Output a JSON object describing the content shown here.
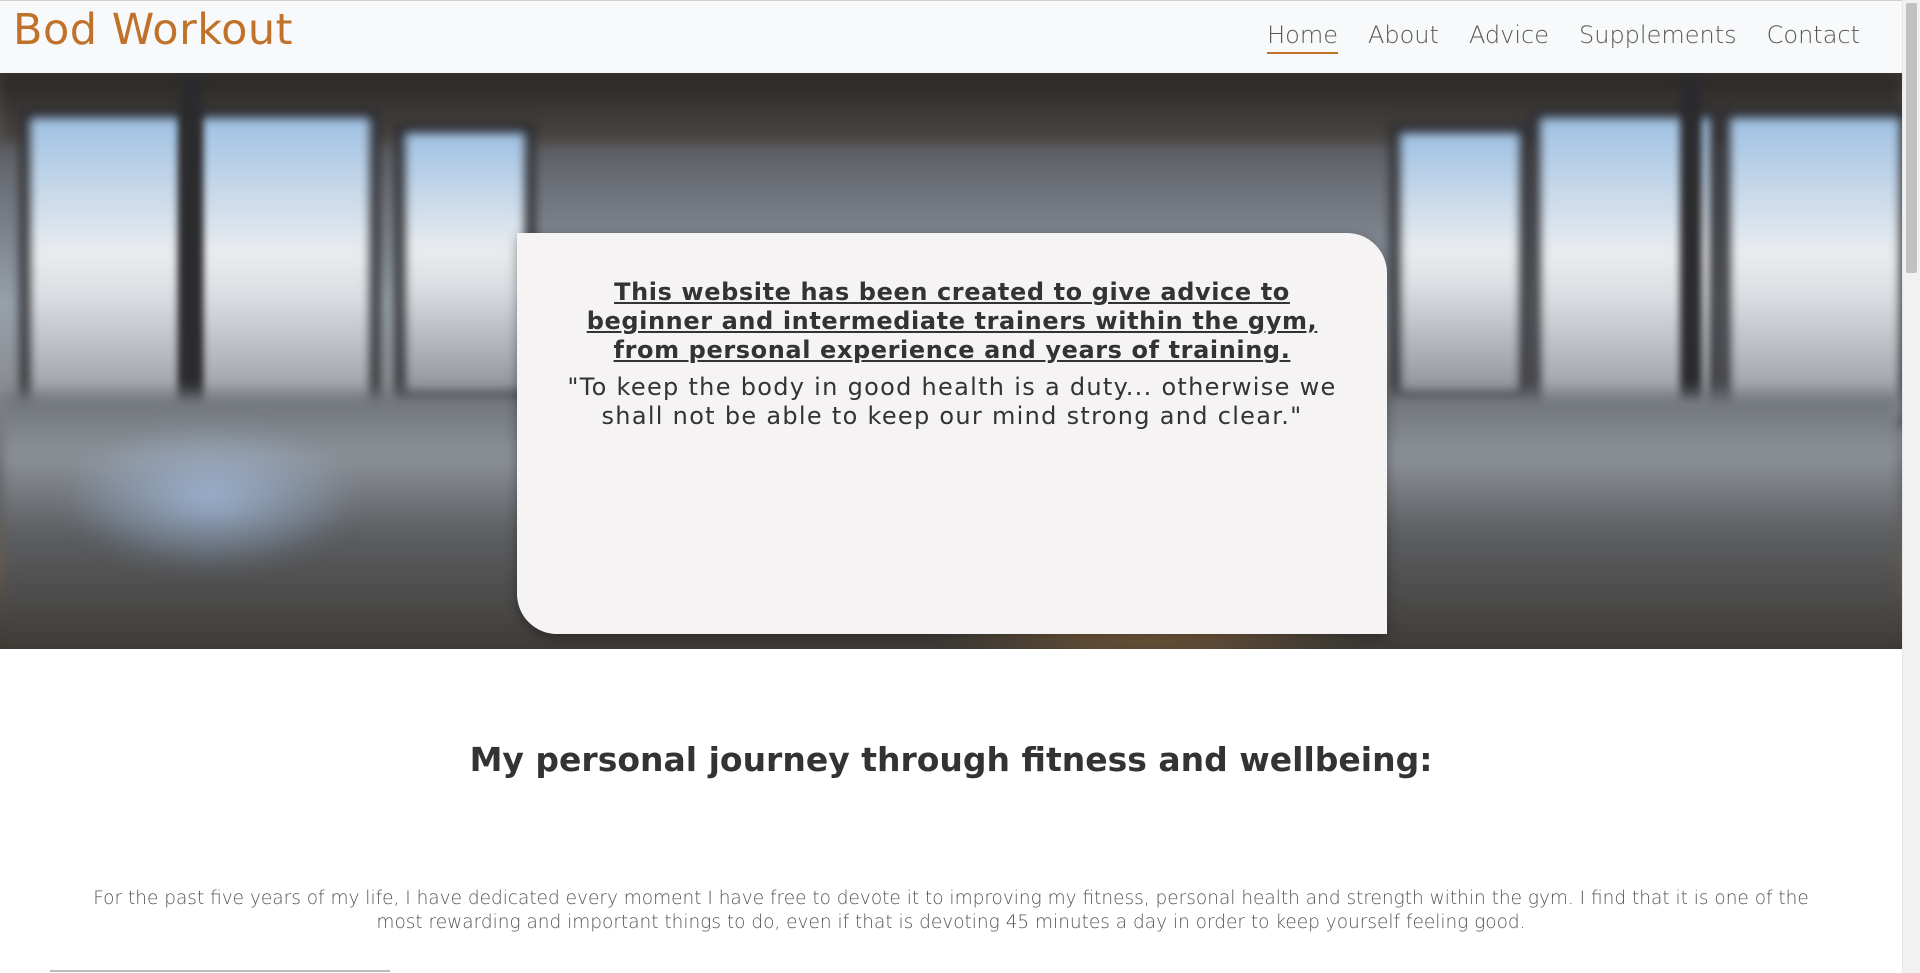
{
  "brand": {
    "name": "Bod Workout",
    "color": "#c0722a"
  },
  "nav": {
    "items": [
      {
        "label": "Home",
        "active": true
      },
      {
        "label": "About",
        "active": false
      },
      {
        "label": "Advice",
        "active": false
      },
      {
        "label": "Supplements",
        "active": false
      },
      {
        "label": "Contact",
        "active": false
      }
    ]
  },
  "hero": {
    "heading": "This website has been created to give advice to beginner and intermediate trainers within the gym, from personal experience and years of training.",
    "quote": "\"To keep the body in good health is a duty... otherwise we shall not be able to keep our mind strong and clear.\""
  },
  "journey": {
    "title": "My personal journey through fitness and wellbeing:",
    "text": "For the past five years of my life, I have dedicated every moment I have free to devote it to improving my fitness, personal health and strength within the gym. I find that it is one of the most rewarding and important things to do, even if that is devoting 45 minutes a day in order to keep yourself feeling good."
  }
}
